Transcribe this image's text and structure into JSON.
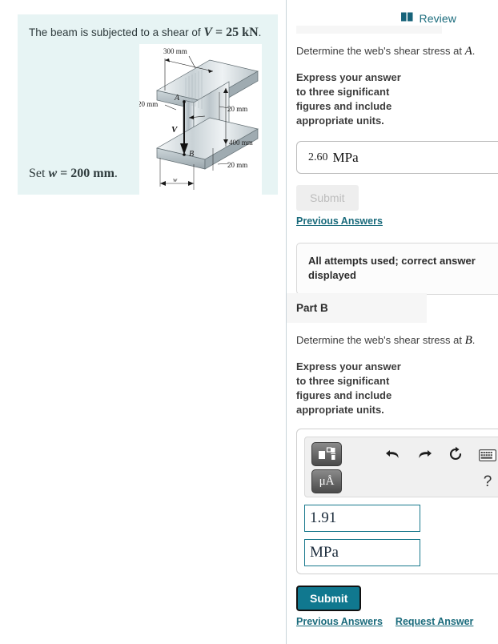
{
  "problem": {
    "statement_prefix": "The beam is subjected to a shear of ",
    "statement_var": "V",
    "statement_eq": " = 25 kN",
    "statement_suffix": ".",
    "set_prefix": "Set ",
    "set_var": "w",
    "set_value": " = 200 mm",
    "set_suffix": "."
  },
  "figure": {
    "name": "i-beam-shear-diagram",
    "labels": {
      "top_flange_width": "300 mm",
      "left_thickness": "20 mm",
      "right_thickness": "20 mm",
      "web_height": "400 mm",
      "bottom_thickness": "20 mm",
      "bottom_width": "w",
      "point_a": "A",
      "point_b": "B",
      "shear_force": "V"
    }
  },
  "right": {
    "review_label": "Review",
    "review_icon": "book-icon",
    "part_a": {
      "question_prefix": "Determine the web's shear stress at ",
      "question_var": "A",
      "question_suffix": ".",
      "instructions": "Express your answer to three significant figures and include appropriate units.",
      "answer_value": "2.60",
      "answer_units": "MPa",
      "submit_label": "Submit",
      "previous_answers_label": "Previous Answers",
      "feedback": "All attempts used; correct answer displayed"
    },
    "part_b": {
      "header": "Part B",
      "question_prefix": "Determine the web's shear stress at ",
      "question_var": "B",
      "question_suffix": ".",
      "instructions": "Express your answer to three significant figures and include appropriate units.",
      "toolbar": {
        "template_icon": "formula-template-icon",
        "units_label": "μÅ",
        "undo_icon": "undo-arrow-icon",
        "redo_icon": "redo-arrow-icon",
        "reset_icon": "reset-circular-arrow-icon",
        "keyboard_icon": "keyboard-icon",
        "help_label": "?"
      },
      "answer_value": "1.91",
      "answer_units": "MPa",
      "submit_label": "Submit",
      "previous_answers_label": "Previous Answers",
      "request_answer_label": "Request Answer"
    }
  },
  "colors": {
    "panel_bg": "#e7f4f4",
    "link": "#1a6b7c",
    "submit_active": "#10788f",
    "field_border": "#17788c"
  }
}
